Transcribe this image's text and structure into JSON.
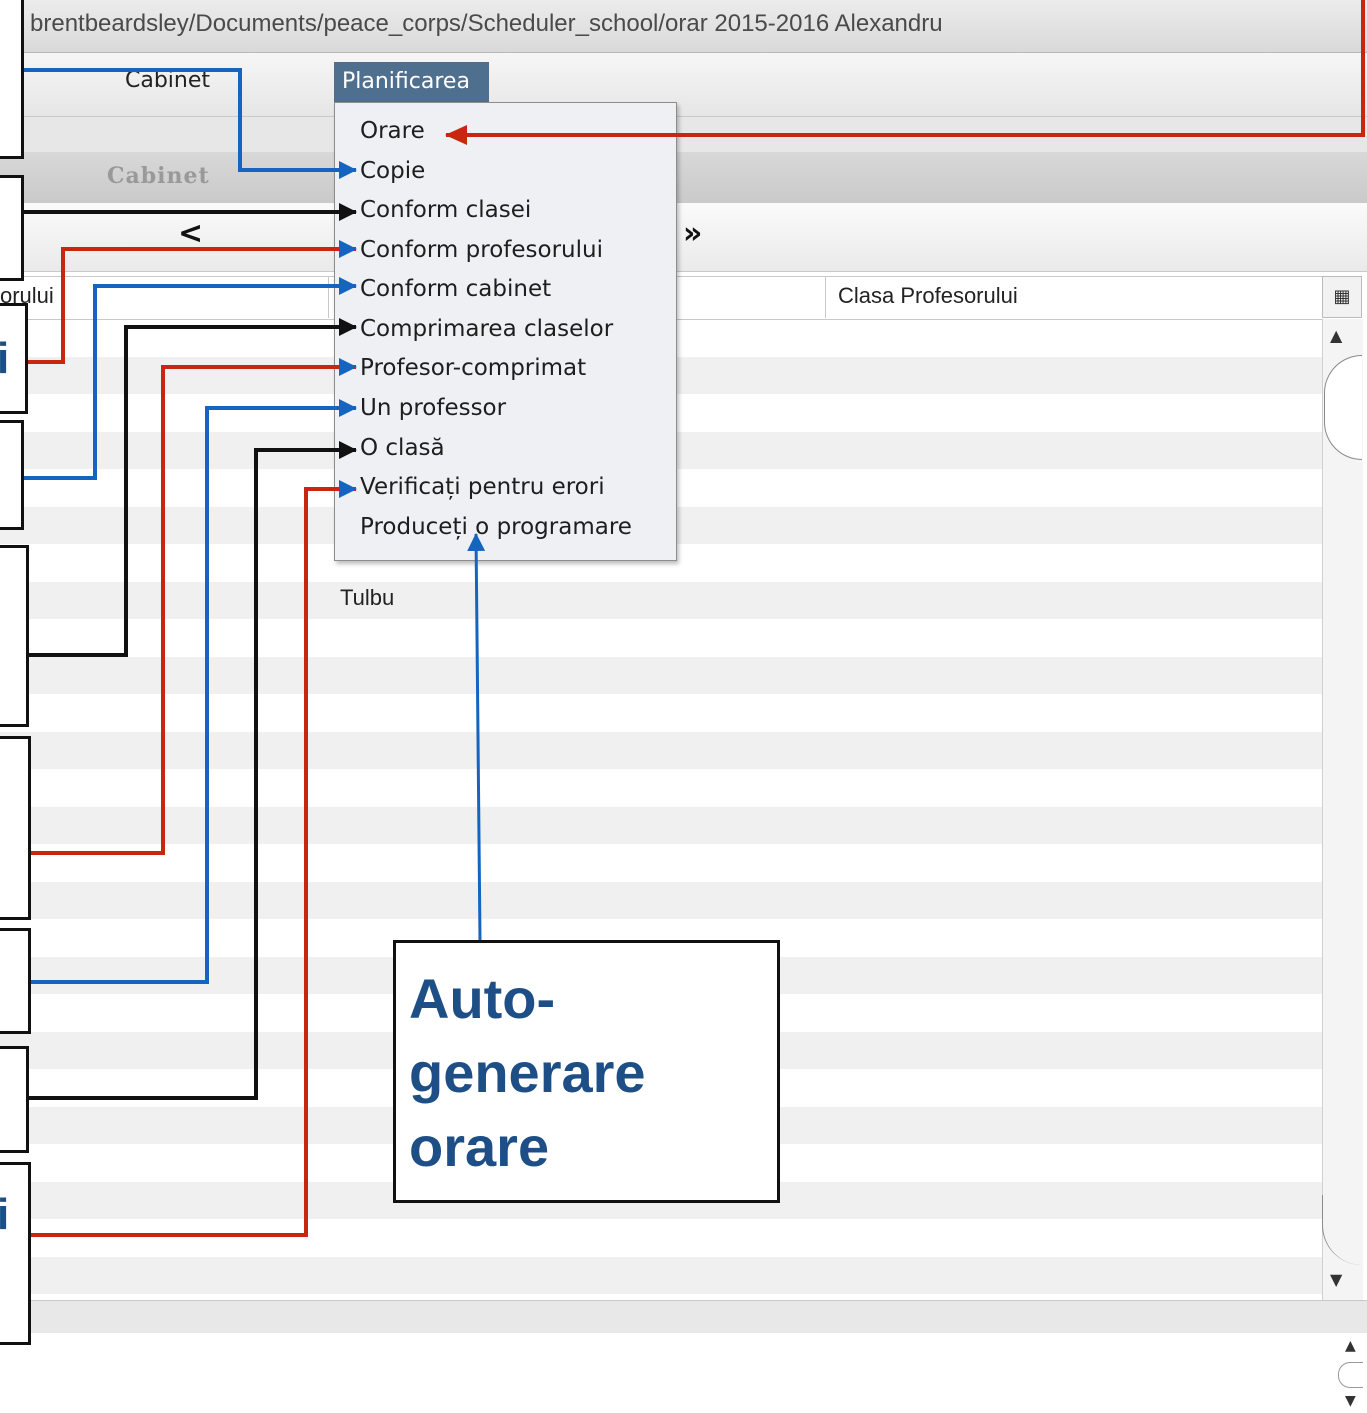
{
  "window": {
    "title": "brentbeardsley/Documents/peace_corps/Scheduler_school/orar 2015-2016 Alexandru"
  },
  "menubar": {
    "cabinet": "Cabinet",
    "planificarea": "Planificarea"
  },
  "tabs": {
    "cabinet": "Cabinet"
  },
  "nav": {
    "prev": "<",
    "next": "»"
  },
  "table": {
    "headers": [
      "orului",
      "Clasa Profesorului"
    ],
    "cells": {
      "tulbu": "Tulbu"
    }
  },
  "dropdown": {
    "items": [
      "Orare",
      "Copie",
      "Conform clasei",
      "Conform profesorului",
      "Conform cabinet",
      "Comprimarea claselor",
      "Profesor-comprimat",
      "Un professor",
      "O clasă",
      "Verificați pentru erori",
      "Produceți o programare"
    ]
  },
  "annotations": {
    "callout": "Auto-generare orare",
    "fragment_glyphs": [
      "i",
      "i"
    ]
  },
  "colors": {
    "arrow_red": "#c8260f",
    "arrow_blue": "#1565c0",
    "arrow_black": "#111111",
    "callout_text": "#1d4f86",
    "menu_highlight": "#4f6f8f"
  }
}
